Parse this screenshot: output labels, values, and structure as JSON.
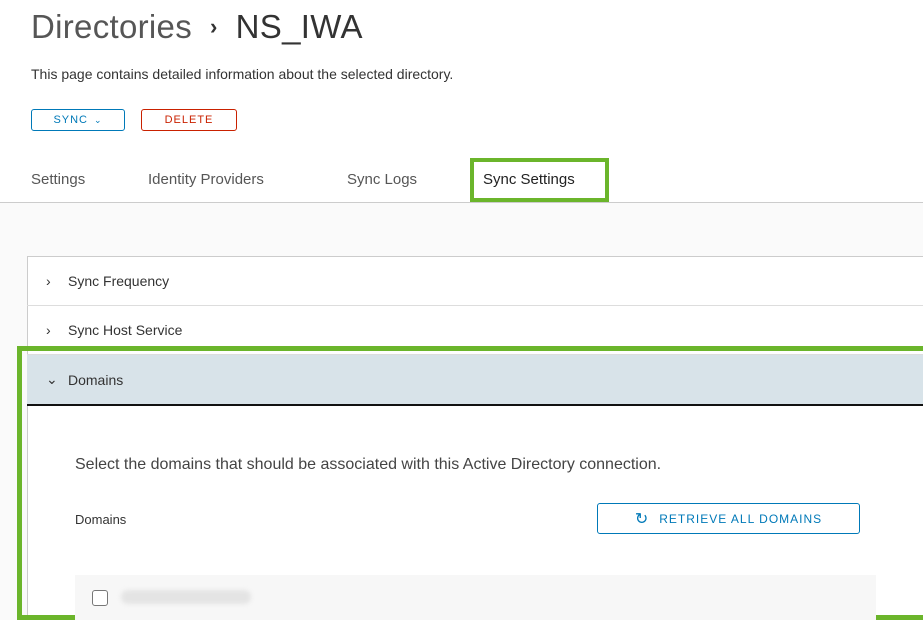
{
  "breadcrumb": {
    "parent": "Directories",
    "separator": "›",
    "current": "NS_IWA"
  },
  "description": "This page contains detailed information about the selected directory.",
  "actions": {
    "sync_label": "SYNC",
    "sync_caret": "⌄",
    "delete_label": "DELETE"
  },
  "tabs": [
    {
      "label": "Settings"
    },
    {
      "label": "Identity Providers"
    },
    {
      "label": "Sync Logs"
    },
    {
      "label": "Sync Settings"
    }
  ],
  "sections": [
    {
      "label": "Sync Frequency",
      "chevron": "›"
    },
    {
      "label": "Sync Host Service",
      "chevron": "›"
    },
    {
      "label": "Domains",
      "chevron": "⌄"
    }
  ],
  "domains": {
    "instruction": "Select the domains that should be associated with this Active Directory connection.",
    "label": "Domains",
    "retrieve_label": "RETRIEVE ALL DOMAINS",
    "retrieve_icon": "refresh-icon",
    "retrieve_glyph": "↻",
    "items": [
      {
        "name": ""
      }
    ]
  },
  "colors": {
    "accent": "#0079b8",
    "danger": "#c92100",
    "highlight": "#6bb52b",
    "expanded_row": "#d8e3e9"
  }
}
